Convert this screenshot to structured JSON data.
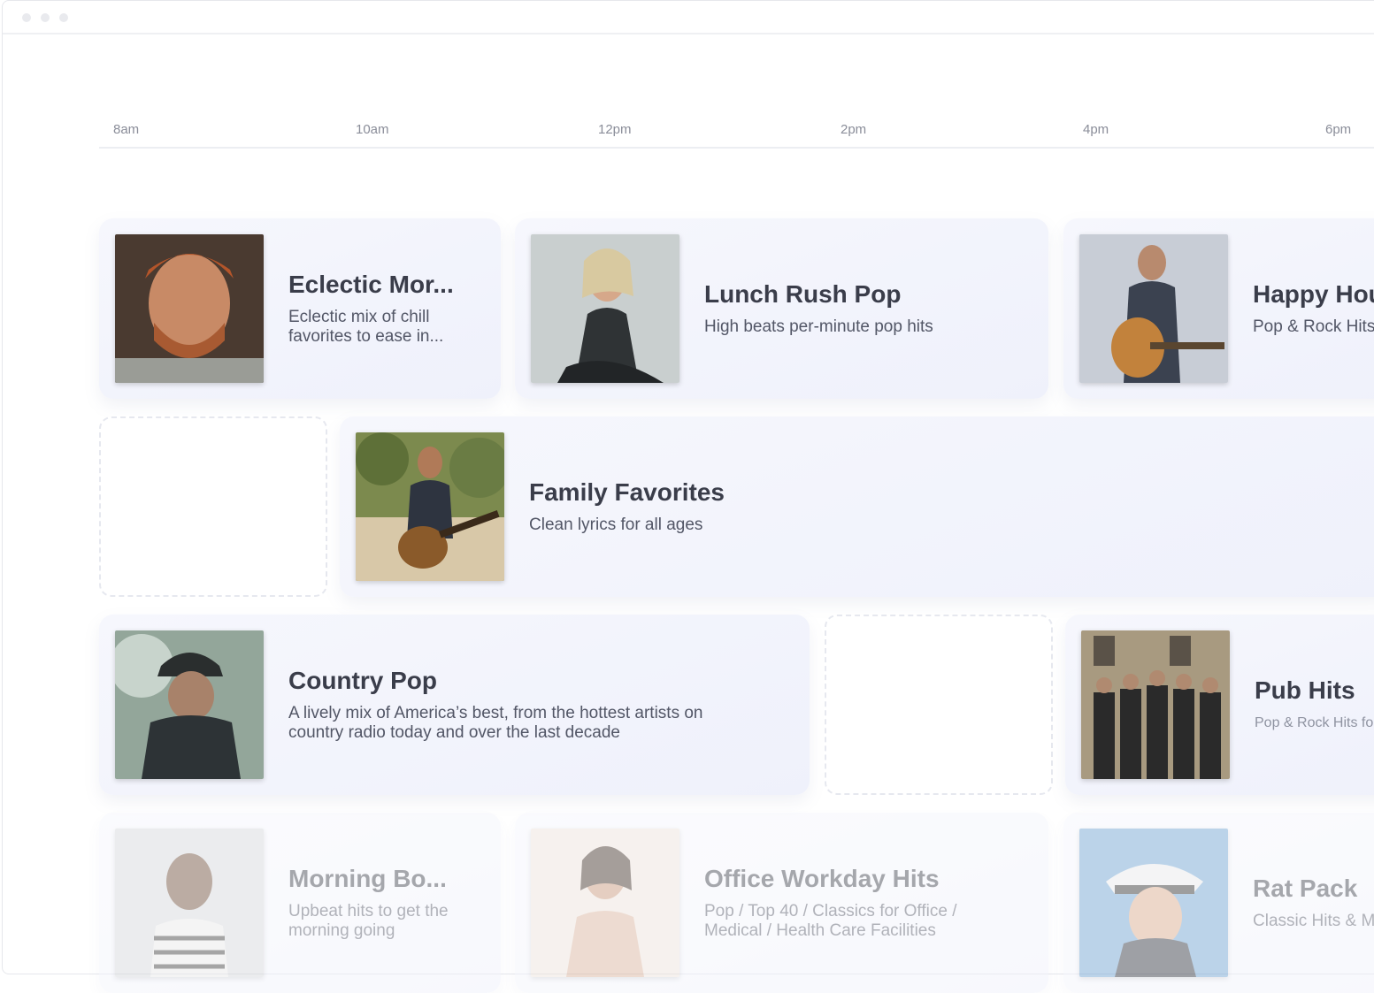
{
  "timeline": {
    "ticks": [
      "8am",
      "10am",
      "12pm",
      "2pm",
      "4pm",
      "6pm"
    ]
  },
  "rows": [
    [
      {
        "title": "Eclectic Mor...",
        "description": "Eclectic mix of chill favorites to ease in..."
      },
      {
        "title": "Lunch Rush Pop",
        "description": "High beats per-minute pop hits"
      },
      {
        "title": "Happy Hou",
        "description": "Pop & Rock Hits"
      }
    ],
    [
      {
        "title": "Family Favorites",
        "description": "Clean lyrics for all ages"
      }
    ],
    [
      {
        "title": "Country Pop",
        "description": "A lively mix of America’s best, from the hottest artists on country radio today and over the last decade"
      },
      {
        "title": "Pub Hits",
        "description": "Pop & Rock Hits fo"
      }
    ],
    [
      {
        "title": "Morning Bo...",
        "description": "Upbeat hits to get the morning going"
      },
      {
        "title": "Office Workday Hits",
        "description": "Pop / Top 40 / Classics for Office / Medical / Health Care Facilities"
      },
      {
        "title": "Rat Pack",
        "description": "Classic Hits & M"
      }
    ]
  ],
  "colors": {
    "card_bg": "#f3f4fc",
    "tick_text": "#8a8d99",
    "title_text": "#3a3d4a"
  }
}
